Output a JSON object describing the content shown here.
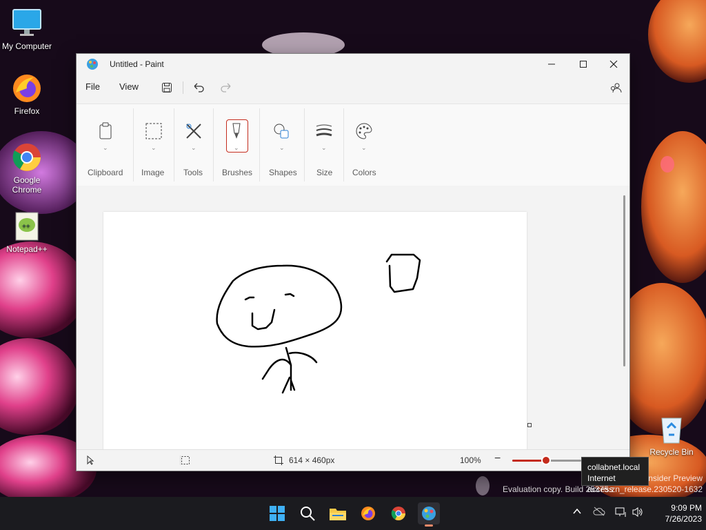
{
  "desktop": {
    "icons": [
      {
        "label": "My Computer",
        "icon": "monitor-icon"
      },
      {
        "label": "Firefox",
        "icon": "firefox-icon"
      },
      {
        "label": "Google Chrome",
        "icon": "chrome-icon"
      },
      {
        "label": "Notepad++",
        "icon": "notepad-plus-plus-icon"
      },
      {
        "label": "Recycle Bin",
        "icon": "recycle-bin-icon"
      }
    ],
    "watermark": {
      "line1": "Insider Preview",
      "line2": "Evaluation copy. Build 25375.zn_release.230520-1632"
    }
  },
  "paint": {
    "title": "Untitled - Paint",
    "menu": {
      "file": "File",
      "view": "View"
    },
    "ribbon": {
      "groups": [
        {
          "label": "Clipboard",
          "icon": "clipboard-icon"
        },
        {
          "label": "Image",
          "icon": "selection-icon"
        },
        {
          "label": "Tools",
          "icon": "tools-icon"
        },
        {
          "label": "Brushes",
          "icon": "brush-icon",
          "active": true
        },
        {
          "label": "Shapes",
          "icon": "shapes-icon"
        },
        {
          "label": "Size",
          "icon": "size-icon"
        },
        {
          "label": "Colors",
          "icon": "palette-icon"
        }
      ]
    },
    "status": {
      "canvas_size": "614 × 460px",
      "zoom": "100%"
    }
  },
  "tooltip": {
    "line1": "collabnet.local",
    "line2": "Internet access"
  },
  "taskbar": {
    "apps": [
      "start-icon",
      "search-icon",
      "file-explorer-icon",
      "firefox-icon",
      "chrome-icon",
      "paint-icon"
    ],
    "time": "9:09 PM",
    "date": "7/26/2023"
  },
  "colors": {
    "accent": "#c42b1c",
    "window_bg": "#f3f3f3",
    "taskbar": "#1b1b1f"
  }
}
